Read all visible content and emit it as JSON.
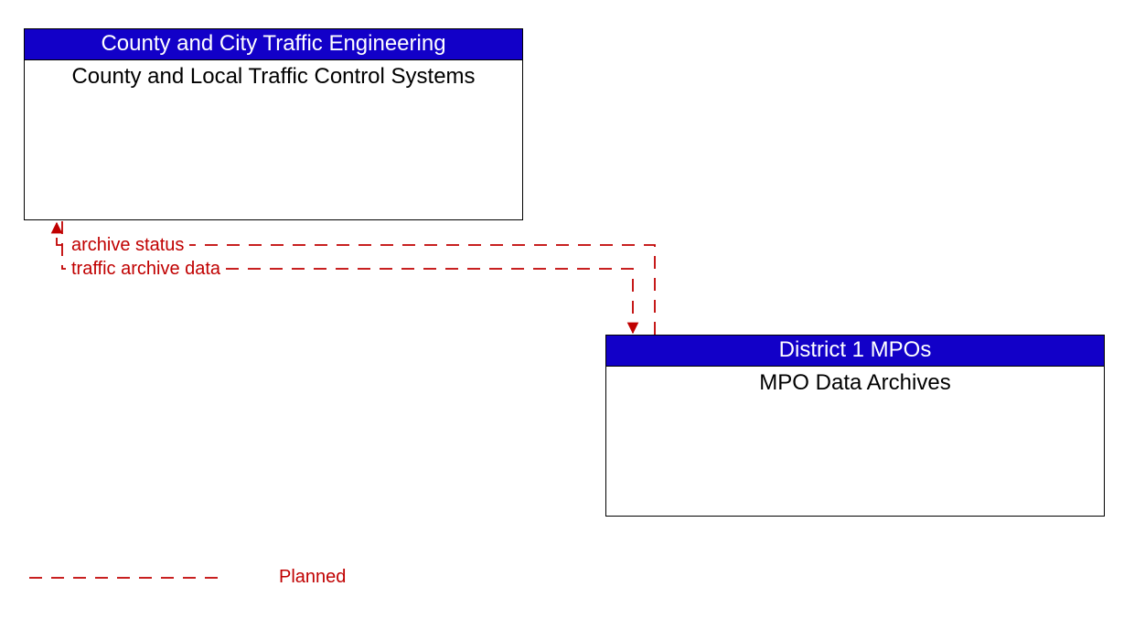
{
  "nodes": {
    "top_left": {
      "header": "County and City Traffic Engineering",
      "body": "County and Local Traffic Control Systems"
    },
    "bottom_right": {
      "header": "District 1 MPOs",
      "body": "MPO Data Archives"
    }
  },
  "flows": {
    "archive_status": "archive status",
    "traffic_archive_data": "traffic archive data"
  },
  "legend": {
    "planned": "Planned"
  },
  "colors": {
    "header_bg": "#1200c8",
    "flow": "#c00000"
  }
}
